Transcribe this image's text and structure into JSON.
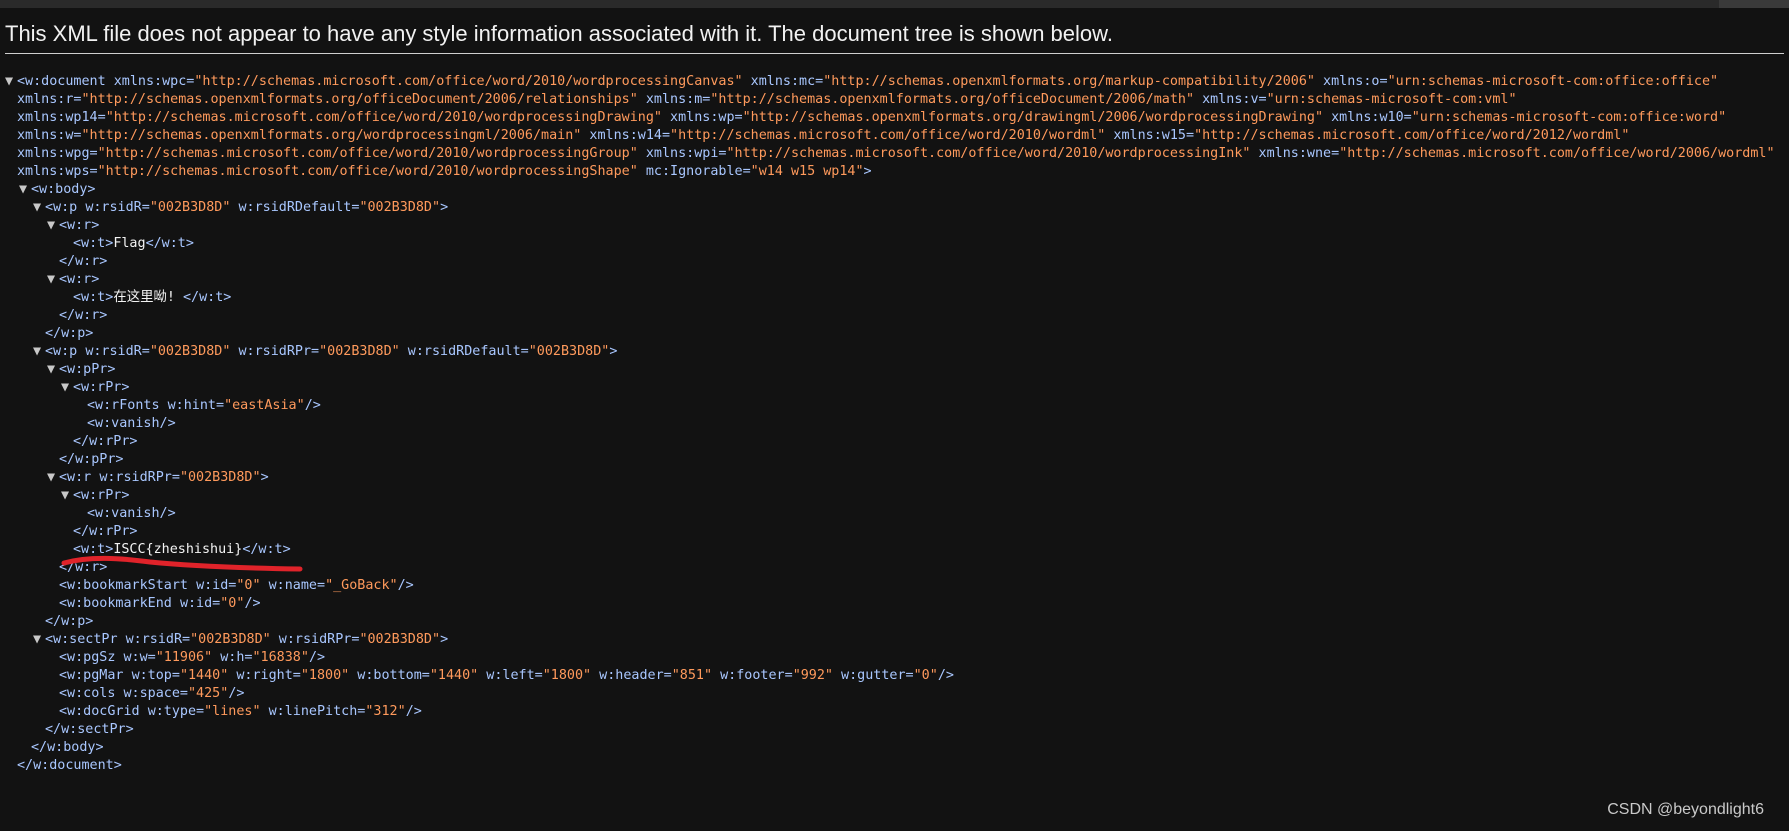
{
  "banner": "This XML file does not appear to have any style information associated with it. The document tree is shown below.",
  "watermark": "CSDN @beyondlight6",
  "lines": [
    {
      "indent": 0,
      "toggle": "▼",
      "parts": [
        [
          "t",
          "<w:document "
        ],
        [
          "n",
          "xmlns:wpc="
        ],
        [
          "v",
          "\"http://schemas.microsoft.com/office/word/2010/wordprocessingCanvas\""
        ],
        [
          "n",
          " xmlns:mc="
        ],
        [
          "v",
          "\"http://schemas.openxmlformats.org/markup-compatibility/2006\""
        ],
        [
          "n",
          " xmlns:o="
        ],
        [
          "v",
          "\"urn:schemas-microsoft-com:office:office\""
        ]
      ]
    },
    {
      "indent": 0,
      "cont": true,
      "parts": [
        [
          "n",
          "xmlns:r="
        ],
        [
          "v",
          "\"http://schemas.openxmlformats.org/officeDocument/2006/relationships\""
        ],
        [
          "n",
          " xmlns:m="
        ],
        [
          "v",
          "\"http://schemas.openxmlformats.org/officeDocument/2006/math\""
        ],
        [
          "n",
          " xmlns:v="
        ],
        [
          "v",
          "\"urn:schemas-microsoft-com:vml\""
        ]
      ]
    },
    {
      "indent": 0,
      "cont": true,
      "parts": [
        [
          "n",
          "xmlns:wp14="
        ],
        [
          "v",
          "\"http://schemas.microsoft.com/office/word/2010/wordprocessingDrawing\""
        ],
        [
          "n",
          " xmlns:wp="
        ],
        [
          "v",
          "\"http://schemas.openxmlformats.org/drawingml/2006/wordprocessingDrawing\""
        ],
        [
          "n",
          " xmlns:w10="
        ],
        [
          "v",
          "\"urn:schemas-microsoft-com:office:word\""
        ]
      ]
    },
    {
      "indent": 0,
      "cont": true,
      "parts": [
        [
          "n",
          "xmlns:w="
        ],
        [
          "v",
          "\"http://schemas.openxmlformats.org/wordprocessingml/2006/main\""
        ],
        [
          "n",
          " xmlns:w14="
        ],
        [
          "v",
          "\"http://schemas.microsoft.com/office/word/2010/wordml\""
        ],
        [
          "n",
          " xmlns:w15="
        ],
        [
          "v",
          "\"http://schemas.microsoft.com/office/word/2012/wordml\""
        ]
      ]
    },
    {
      "indent": 0,
      "cont": true,
      "parts": [
        [
          "n",
          "xmlns:wpg="
        ],
        [
          "v",
          "\"http://schemas.microsoft.com/office/word/2010/wordprocessingGroup\""
        ],
        [
          "n",
          " xmlns:wpi="
        ],
        [
          "v",
          "\"http://schemas.microsoft.com/office/word/2010/wordprocessingInk\""
        ],
        [
          "n",
          " xmlns:wne="
        ],
        [
          "v",
          "\"http://schemas.microsoft.com/office/word/2006/wordml\""
        ]
      ]
    },
    {
      "indent": 0,
      "cont": true,
      "parts": [
        [
          "n",
          "xmlns:wps="
        ],
        [
          "v",
          "\"http://schemas.microsoft.com/office/word/2010/wordprocessingShape\""
        ],
        [
          "n",
          " mc:Ignorable="
        ],
        [
          "v",
          "\"w14 w15 wp14\""
        ],
        [
          "t",
          ">"
        ]
      ]
    },
    {
      "indent": 1,
      "toggle": "▼",
      "parts": [
        [
          "t",
          "<w:body>"
        ]
      ]
    },
    {
      "indent": 2,
      "toggle": "▼",
      "parts": [
        [
          "t",
          "<w:p "
        ],
        [
          "n",
          "w:rsidR="
        ],
        [
          "v",
          "\"002B3D8D\""
        ],
        [
          "n",
          " w:rsidRDefault="
        ],
        [
          "v",
          "\"002B3D8D\""
        ],
        [
          "t",
          ">"
        ]
      ]
    },
    {
      "indent": 3,
      "toggle": "▼",
      "parts": [
        [
          "t",
          "<w:r>"
        ]
      ]
    },
    {
      "indent": 4,
      "parts": [
        [
          "t",
          "<w:t>"
        ],
        [
          "x",
          "Flag"
        ],
        [
          "t",
          "</w:t>"
        ]
      ]
    },
    {
      "indent": 3,
      "parts": [
        [
          "t",
          "</w:r>"
        ]
      ]
    },
    {
      "indent": 3,
      "toggle": "▼",
      "parts": [
        [
          "t",
          "<w:r>"
        ]
      ]
    },
    {
      "indent": 4,
      "parts": [
        [
          "t",
          "<w:t>"
        ],
        [
          "x",
          "在这里呦! "
        ],
        [
          "t",
          "</w:t>"
        ]
      ]
    },
    {
      "indent": 3,
      "parts": [
        [
          "t",
          "</w:r>"
        ]
      ]
    },
    {
      "indent": 2,
      "parts": [
        [
          "t",
          "</w:p>"
        ]
      ]
    },
    {
      "indent": 2,
      "toggle": "▼",
      "parts": [
        [
          "t",
          "<w:p "
        ],
        [
          "n",
          "w:rsidR="
        ],
        [
          "v",
          "\"002B3D8D\""
        ],
        [
          "n",
          " w:rsidRPr="
        ],
        [
          "v",
          "\"002B3D8D\""
        ],
        [
          "n",
          " w:rsidRDefault="
        ],
        [
          "v",
          "\"002B3D8D\""
        ],
        [
          "t",
          ">"
        ]
      ]
    },
    {
      "indent": 3,
      "toggle": "▼",
      "parts": [
        [
          "t",
          "<w:pPr>"
        ]
      ]
    },
    {
      "indent": 4,
      "toggle": "▼",
      "parts": [
        [
          "t",
          "<w:rPr>"
        ]
      ]
    },
    {
      "indent": 5,
      "parts": [
        [
          "t",
          "<w:rFonts "
        ],
        [
          "n",
          "w:hint="
        ],
        [
          "v",
          "\"eastAsia\""
        ],
        [
          "t",
          "/>"
        ]
      ]
    },
    {
      "indent": 5,
      "parts": [
        [
          "t",
          "<w:vanish/>"
        ]
      ]
    },
    {
      "indent": 4,
      "parts": [
        [
          "t",
          "</w:rPr>"
        ]
      ]
    },
    {
      "indent": 3,
      "parts": [
        [
          "t",
          "</w:pPr>"
        ]
      ]
    },
    {
      "indent": 3,
      "toggle": "▼",
      "parts": [
        [
          "t",
          "<w:r "
        ],
        [
          "n",
          "w:rsidRPr="
        ],
        [
          "v",
          "\"002B3D8D\""
        ],
        [
          "t",
          ">"
        ]
      ]
    },
    {
      "indent": 4,
      "toggle": "▼",
      "parts": [
        [
          "t",
          "<w:rPr>"
        ]
      ]
    },
    {
      "indent": 5,
      "parts": [
        [
          "t",
          "<w:vanish/>"
        ]
      ]
    },
    {
      "indent": 4,
      "parts": [
        [
          "t",
          "</w:rPr>"
        ]
      ]
    },
    {
      "indent": 4,
      "parts": [
        [
          "t",
          "<w:t>"
        ],
        [
          "x",
          "ISCC{zheshishui}"
        ],
        [
          "t",
          "</w:t>"
        ]
      ]
    },
    {
      "indent": 3,
      "parts": [
        [
          "t",
          "</w:r>"
        ]
      ]
    },
    {
      "indent": 3,
      "parts": [
        [
          "t",
          "<w:bookmarkStart "
        ],
        [
          "n",
          "w:id="
        ],
        [
          "v",
          "\"0\""
        ],
        [
          "n",
          " w:name="
        ],
        [
          "v",
          "\"_GoBack\""
        ],
        [
          "t",
          "/>"
        ]
      ]
    },
    {
      "indent": 3,
      "parts": [
        [
          "t",
          "<w:bookmarkEnd "
        ],
        [
          "n",
          "w:id="
        ],
        [
          "v",
          "\"0\""
        ],
        [
          "t",
          "/>"
        ]
      ]
    },
    {
      "indent": 2,
      "parts": [
        [
          "t",
          "</w:p>"
        ]
      ]
    },
    {
      "indent": 2,
      "toggle": "▼",
      "parts": [
        [
          "t",
          "<w:sectPr "
        ],
        [
          "n",
          "w:rsidR="
        ],
        [
          "v",
          "\"002B3D8D\""
        ],
        [
          "n",
          " w:rsidRPr="
        ],
        [
          "v",
          "\"002B3D8D\""
        ],
        [
          "t",
          ">"
        ]
      ]
    },
    {
      "indent": 3,
      "parts": [
        [
          "t",
          "<w:pgSz "
        ],
        [
          "n",
          "w:w="
        ],
        [
          "v",
          "\"11906\""
        ],
        [
          "n",
          " w:h="
        ],
        [
          "v",
          "\"16838\""
        ],
        [
          "t",
          "/>"
        ]
      ]
    },
    {
      "indent": 3,
      "parts": [
        [
          "t",
          "<w:pgMar "
        ],
        [
          "n",
          "w:top="
        ],
        [
          "v",
          "\"1440\""
        ],
        [
          "n",
          " w:right="
        ],
        [
          "v",
          "\"1800\""
        ],
        [
          "n",
          " w:bottom="
        ],
        [
          "v",
          "\"1440\""
        ],
        [
          "n",
          " w:left="
        ],
        [
          "v",
          "\"1800\""
        ],
        [
          "n",
          " w:header="
        ],
        [
          "v",
          "\"851\""
        ],
        [
          "n",
          " w:footer="
        ],
        [
          "v",
          "\"992\""
        ],
        [
          "n",
          " w:gutter="
        ],
        [
          "v",
          "\"0\""
        ],
        [
          "t",
          "/>"
        ]
      ]
    },
    {
      "indent": 3,
      "parts": [
        [
          "t",
          "<w:cols "
        ],
        [
          "n",
          "w:space="
        ],
        [
          "v",
          "\"425\""
        ],
        [
          "t",
          "/>"
        ]
      ]
    },
    {
      "indent": 3,
      "parts": [
        [
          "t",
          "<w:docGrid "
        ],
        [
          "n",
          "w:type="
        ],
        [
          "v",
          "\"lines\""
        ],
        [
          "n",
          " w:linePitch="
        ],
        [
          "v",
          "\"312\""
        ],
        [
          "t",
          "/>"
        ]
      ]
    },
    {
      "indent": 2,
      "parts": [
        [
          "t",
          "</w:sectPr>"
        ]
      ]
    },
    {
      "indent": 1,
      "parts": [
        [
          "t",
          "</w:body>"
        ]
      ]
    },
    {
      "indent": 0,
      "parts": [
        [
          "t",
          "</w:document>"
        ]
      ]
    }
  ],
  "colors": {
    "background": "#121212",
    "tag": "#a9c7ff",
    "attr_value": "#ff9a5c",
    "text": "#f3f3f3",
    "annotation": "#e0232a"
  }
}
